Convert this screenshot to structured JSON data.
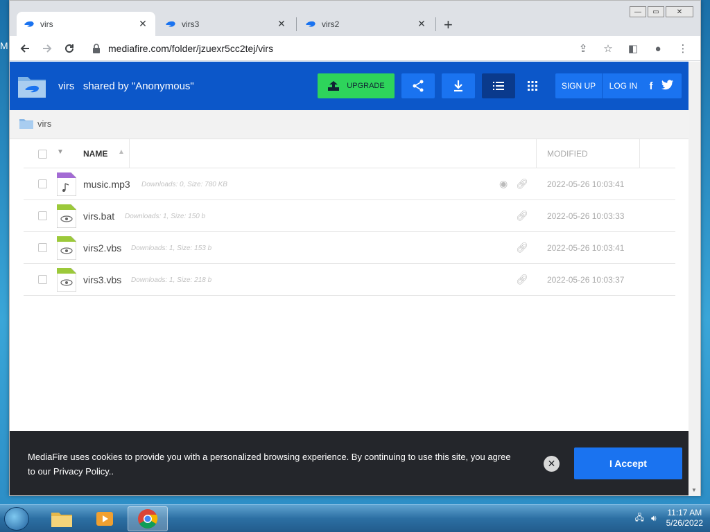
{
  "desktop": {
    "partial_label": "M"
  },
  "browser": {
    "tabs": [
      {
        "title": "virs",
        "active": true
      },
      {
        "title": "virs3",
        "active": false
      },
      {
        "title": "virs2",
        "active": false
      }
    ],
    "url": "mediafire.com/folder/jzuexr5cc2tej/virs"
  },
  "mediafire": {
    "folder_name": "virs",
    "shared_by": "shared by \"Anonymous\"",
    "upgrade_label": "UPGRADE",
    "signup_label": "SIGN UP",
    "login_label": "LOG IN",
    "breadcrumb": "virs",
    "columns": {
      "name": "NAME",
      "modified": "MODIFIED"
    },
    "files": [
      {
        "name": "music.mp3",
        "meta": "Downloads: 0, Size: 780 KB",
        "modified": "2022-05-26 10:03:41",
        "type": "audio"
      },
      {
        "name": "virs.bat",
        "meta": "Downloads: 1, Size: 150 b",
        "modified": "2022-05-26 10:03:33",
        "type": "exec"
      },
      {
        "name": "virs2.vbs",
        "meta": "Downloads: 1, Size: 153 b",
        "modified": "2022-05-26 10:03:41",
        "type": "exec"
      },
      {
        "name": "virs3.vbs",
        "meta": "Downloads: 1, Size: 218 b",
        "modified": "2022-05-26 10:03:37",
        "type": "exec"
      }
    ],
    "cookie": {
      "text": "MediaFire uses cookies to provide you with a personalized browsing experience. By continuing to use this site, you agree to our Privacy Policy..",
      "accept_label": "I Accept"
    }
  },
  "taskbar": {
    "time": "11:17 AM",
    "date": "5/26/2022"
  },
  "colors": {
    "mf_header": "#0c57c9",
    "mf_button": "#1a73f0",
    "upgrade_green": "#2ed45b",
    "cookie_bg": "#24262b"
  }
}
